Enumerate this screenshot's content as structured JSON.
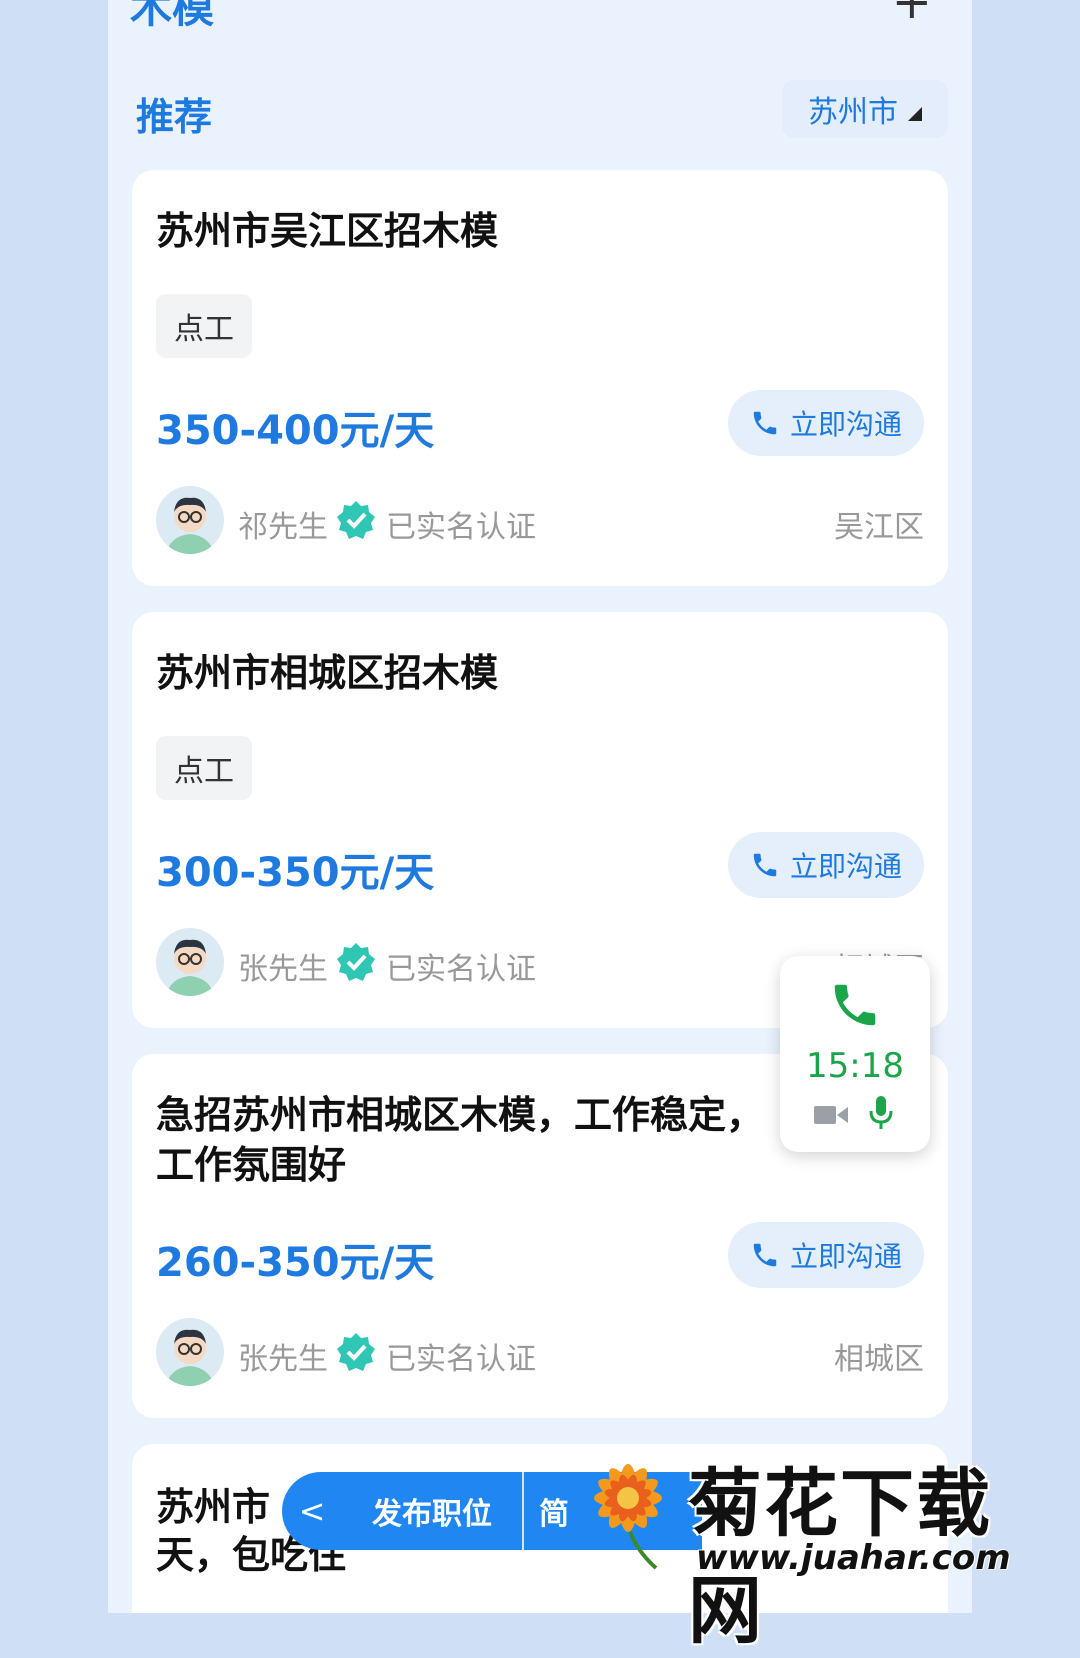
{
  "header": {
    "title": "木模",
    "add_icon": "plus-icon",
    "section_label": "推荐",
    "city": "苏州市"
  },
  "jobs": [
    {
      "title": "苏州市吴江区招木模",
      "tag": "点工",
      "salary": "350-400元/天",
      "call_label": "立即沟通",
      "poster": "祁先生",
      "verified_label": "已实名认证",
      "district": "吴江区"
    },
    {
      "title": "苏州市相城区招木模",
      "tag": "点工",
      "salary": "300-350元/天",
      "call_label": "立即沟通",
      "poster": "张先生",
      "verified_label": "已实名认证",
      "district": "相城区"
    },
    {
      "title": "急招苏州市相城区木模，工作稳定，工作氛围好",
      "salary": "260-350元/天",
      "call_label": "立即沟通",
      "poster": "张先生",
      "verified_label": "已实名认证",
      "district": "相城区"
    },
    {
      "title": "苏州市",
      "title_line2": "天，包吃住"
    }
  ],
  "call_overlay": {
    "timer": "15:18",
    "icons": [
      "phone-icon",
      "video-icon",
      "microphone-icon"
    ]
  },
  "bottom_bar": {
    "publish_label": "发布职位",
    "partial_label": "简"
  },
  "watermark": {
    "brand": "菊花下载网",
    "url": "www.juahar.com"
  },
  "colors": {
    "accent": "#1f7ae0",
    "call_green": "#1aa54a",
    "verify_teal": "#2fc7b4"
  }
}
